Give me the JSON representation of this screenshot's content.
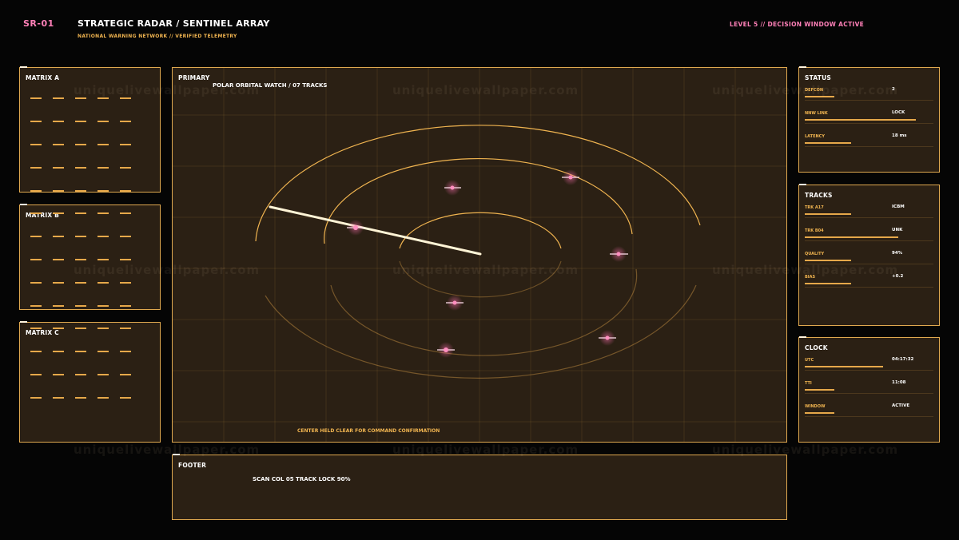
{
  "header": {
    "code": "SR-01",
    "title": "STRATEGIC RADAR / SENTINEL ARRAY",
    "subtitle": "NATIONAL WARNING NETWORK // VERIFIED TELEMETRY",
    "status": "LEVEL 5 // DECISION WINDOW ACTIVE"
  },
  "watermark": "uniquelivewallpaper.com",
  "matrix_a": {
    "title": "MATRIX A"
  },
  "matrix_b": {
    "title": "MATRIX B"
  },
  "matrix_c": {
    "title": "MATRIX C"
  },
  "primary": {
    "title": "PRIMARY",
    "overlay": "POLAR ORBITAL WATCH / 07 TRACKS",
    "note": "CENTER HELD CLEAR FOR COMMAND CONFIRMATION"
  },
  "footer": {
    "title": "FOOTER",
    "text": "SCAN COL 05  TRACK LOCK 90%"
  },
  "status": {
    "title": "STATUS",
    "rows": [
      {
        "label": "DEFCON",
        "value": "2",
        "level": 0.25
      },
      {
        "label": "NNW LINK",
        "value": "LOCK",
        "level": 0.95
      },
      {
        "label": "LATENCY",
        "value": "18 ms",
        "level": 0.4
      }
    ]
  },
  "tracks": {
    "title": "TRACKS",
    "rows": [
      {
        "label": "TRK A17",
        "value": "ICBM",
        "level": 0.4
      },
      {
        "label": "TRK B04",
        "value": "UNK",
        "level": 0.8
      },
      {
        "label": "QUALITY",
        "value": "94%",
        "level": 0.4
      },
      {
        "label": "BIAS",
        "value": "+0.2",
        "level": 0.4
      }
    ]
  },
  "clock": {
    "title": "CLOCK",
    "rows": [
      {
        "label": "UTC",
        "value": "04:17:32",
        "level": 0.67
      },
      {
        "label": "TTI",
        "value": "11:08",
        "level": 0.25
      },
      {
        "label": "WINDOW",
        "value": "ACTIVE",
        "level": 0.25
      }
    ]
  },
  "colors": {
    "accent_pink": "#ff80b8",
    "accent_amber": "#e6a84a",
    "panel_bg": "#2b2014"
  }
}
